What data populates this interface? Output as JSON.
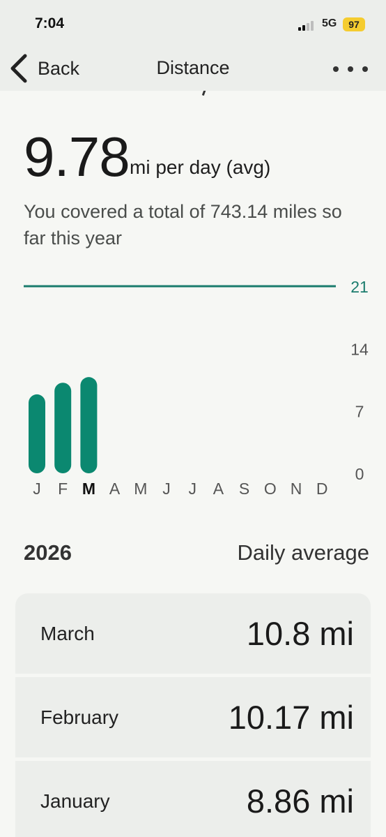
{
  "status_bar": {
    "time": "7:04",
    "network": "5G",
    "battery": "97"
  },
  "nav": {
    "back_label": "Back",
    "title": "Distance",
    "more_icon": "more-horizontal-icon"
  },
  "summary": {
    "value": "9.78",
    "unit": "mi per day (avg)",
    "description": "You covered a total of 743.14 miles so far this year"
  },
  "chart_data": {
    "type": "bar",
    "categories": [
      "J",
      "F",
      "M",
      "A",
      "M",
      "J",
      "J",
      "A",
      "S",
      "O",
      "N",
      "D"
    ],
    "selected_index": 2,
    "values": [
      8.86,
      10.17,
      10.8,
      null,
      null,
      null,
      null,
      null,
      null,
      null,
      null,
      null
    ],
    "y_ticks": [
      "21",
      "14",
      "7",
      "0"
    ],
    "y_tick_values": [
      21,
      14,
      7,
      0
    ],
    "ylim": [
      0,
      21
    ],
    "goal_line_value": 21,
    "bar_color": "#0b8870",
    "goal_line_color": "#1b7c6d",
    "title": "",
    "xlabel": "",
    "ylabel": ""
  },
  "section": {
    "year": "2026",
    "metric": "Daily average"
  },
  "months": [
    {
      "name": "March",
      "value": "10.8 mi"
    },
    {
      "name": "February",
      "value": "10.17 mi"
    },
    {
      "name": "January",
      "value": "8.86 mi"
    }
  ],
  "colors": {
    "accent": "#0b8870",
    "background": "#f6f7f4",
    "card": "#eceeeb",
    "battery": "#f5cc2f"
  }
}
